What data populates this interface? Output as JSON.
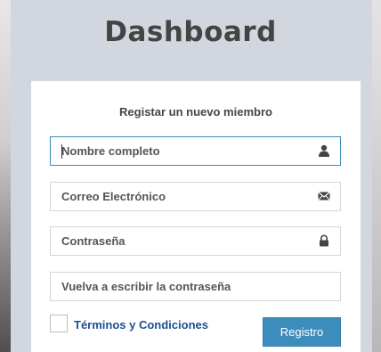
{
  "logo": {
    "text": "Dashboard"
  },
  "form": {
    "title": "Registar un nuevo miembro",
    "fields": [
      {
        "placeholder": "Nombre completo",
        "icon": "user-icon"
      },
      {
        "placeholder": "Correo Electrónico",
        "icon": "envelope-icon"
      },
      {
        "placeholder": "Contraseña",
        "icon": "lock-icon"
      },
      {
        "placeholder": "Vuelva a escribir la contraseña",
        "icon": ""
      }
    ],
    "terms_label": "Términos y Condiciones",
    "submit_label": "Registro"
  },
  "colors": {
    "background": "#d2d6de",
    "accent": "#3c8dbc",
    "link": "#1d4f91",
    "text": "#444444"
  }
}
